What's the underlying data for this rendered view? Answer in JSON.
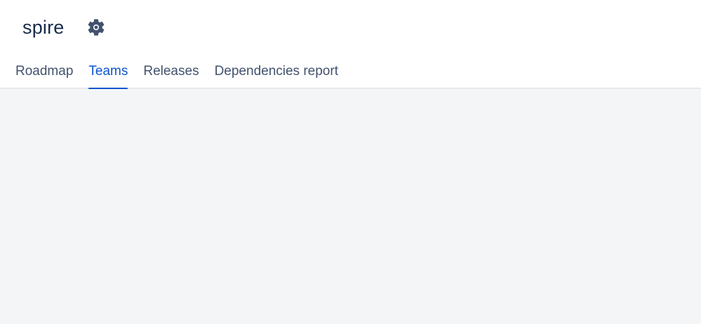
{
  "plan": {
    "title": "spire",
    "settings_icon": "gear-icon"
  },
  "tabs": [
    {
      "label": "Roadmap",
      "active": false
    },
    {
      "label": "Teams",
      "active": true
    },
    {
      "label": "Releases",
      "active": false
    },
    {
      "label": "Dependencies report",
      "active": false
    }
  ],
  "colors": {
    "accent": "#0C55CF",
    "text_primary": "#172B4D",
    "text_secondary": "#42526E",
    "background": "#F4F5F7",
    "header_background": "#FFFFFF"
  }
}
